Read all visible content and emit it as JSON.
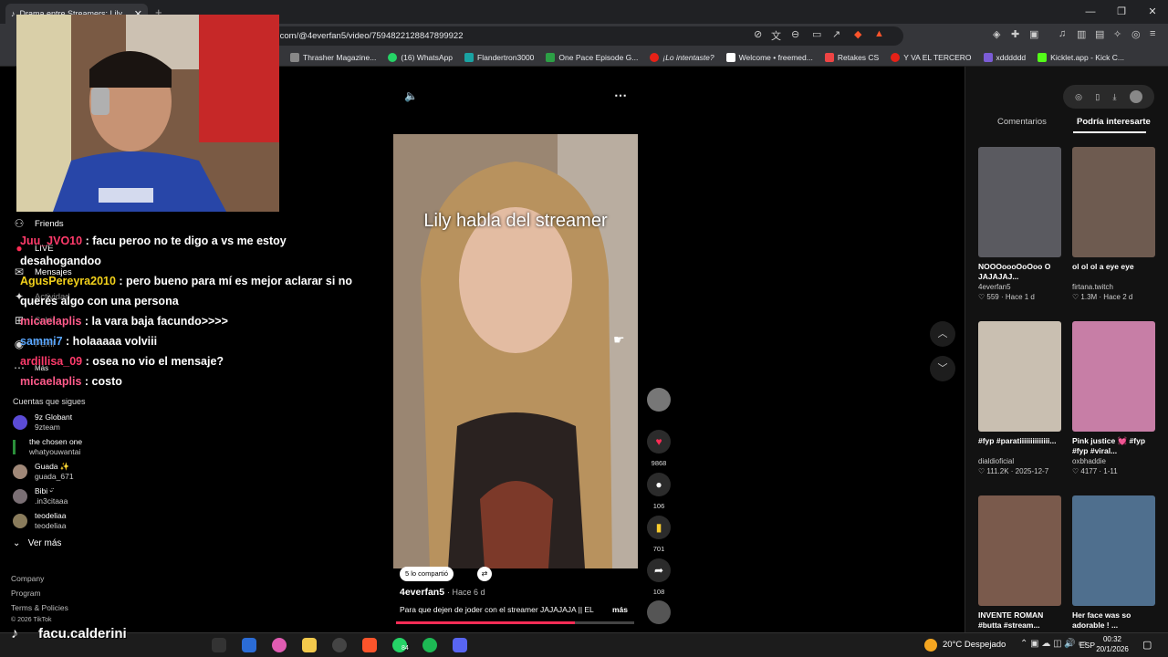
{
  "browser": {
    "tab_title": "Drama entre Streamers: Lily",
    "url": ".com/@4everfan5/video/7594822128847899922",
    "bookmarks": [
      "Thrasher Magazine...",
      "(16) WhatsApp",
      "Flandertron3000",
      "One Pace Episode G...",
      "¡Lo intentaste?",
      "Welcome • freemed...",
      "Retakes CS",
      "Y VA EL TERCERO",
      "xdddddd",
      "Kicklet.app - Kick C..."
    ]
  },
  "sidebar": {
    "nav": [
      "Friends",
      "LIVE",
      "Mensajes",
      "Actividad",
      "Subir",
      "Perfil",
      "Más"
    ],
    "following_title": "Cuentas que sigues",
    "following": [
      {
        "name": "9z Globant",
        "id": "9zteam",
        "color": "#5b4bd6"
      },
      {
        "name": "the chosen one",
        "id": "whatyouwantai",
        "color": "#2b8f3a"
      },
      {
        "name": "Guada ✨",
        "id": "guada_671",
        "color": "#a08878"
      },
      {
        "name": "Bibi ᵕ̈",
        "id": ".in3citaaa",
        "color": "#7a6f74"
      },
      {
        "name": "teodeliaa",
        "id": "teodeliaa",
        "color": "#8a7c5c"
      }
    ],
    "see_more": "Ver más",
    "footer": [
      "Company",
      "Program",
      "Terms & Policies",
      "© 2026 TikTok"
    ]
  },
  "chat": [
    {
      "user": "Juu_JVO10",
      "text": ": facu peroo no te digo a vs me estoy desahogandoo",
      "color": "#ff3b6b"
    },
    {
      "user": "AgusPereyra2010",
      "text": ": pero bueno para mí es mejor aclarar si no querés algo con una persona",
      "color": "#f2d11b"
    },
    {
      "user": "micaelaplis",
      "text": ": la vara baja facundo>>>>",
      "color": "#ff5a8a"
    },
    {
      "user": "sammi7",
      "text": ": holaaaaa volviii",
      "color": "#5aa7ff"
    },
    {
      "user": "ardillisa_09",
      "text": ": osea no vio el mensaje?",
      "color": "#ff3b6b"
    },
    {
      "user": "micaelaplis",
      "text": ": costo",
      "color": "#ff5a8a"
    }
  ],
  "video": {
    "caption": "Lily habla del streamer",
    "shared_label": "5 lo compartió",
    "author": "4everfan5",
    "posted": "· Hace 6 d",
    "description": "Para que dejen de joder con el streamer JAJAJAJA || EL",
    "more": "más",
    "progress": 0.75,
    "likes": "9868",
    "comments": "106",
    "saves": "701",
    "shares": "108"
  },
  "right_panel": {
    "tabs": [
      "Comentarios",
      "Podría interesarte"
    ],
    "cards": [
      {
        "title": "NOOOoooOoOoo O JAJAJAJ...",
        "author": "4everfan5",
        "meta": "♡ 559 · Hace 1 d",
        "color": "#5a5a60"
      },
      {
        "title": "ol ol ol a eye eye",
        "author": "firtana.twitch",
        "meta": "♡ 1.3M · Hace 2 d",
        "color": "#6e5b50"
      },
      {
        "title": "#fyp #paratiiiiiiiiiiiiii...",
        "author": "dialdioficial",
        "meta": "♡ 111.2K · 2025-12-7",
        "color": "#c9bfb1"
      },
      {
        "title": "Pink justice 💓 #fyp #fyp #viral...",
        "author": "oxbhaddie",
        "meta": "♡ 4177 · 1-11",
        "color": "#c77ea6"
      },
      {
        "title": "INVENTE ROMAN #butta #stream...",
        "author": "",
        "meta": "",
        "color": "#7a5a4c"
      },
      {
        "title": "Her face was so adorable ! ...",
        "author": "",
        "meta": "",
        "color": "#4f6f8e"
      }
    ]
  },
  "overlay": {
    "streamer_name": "facu.calderini"
  },
  "taskbar": {
    "weather": "20°C  Despejado",
    "lang": "ESP",
    "time": "00:32",
    "date": "20/1/2026",
    "badge": "84"
  }
}
